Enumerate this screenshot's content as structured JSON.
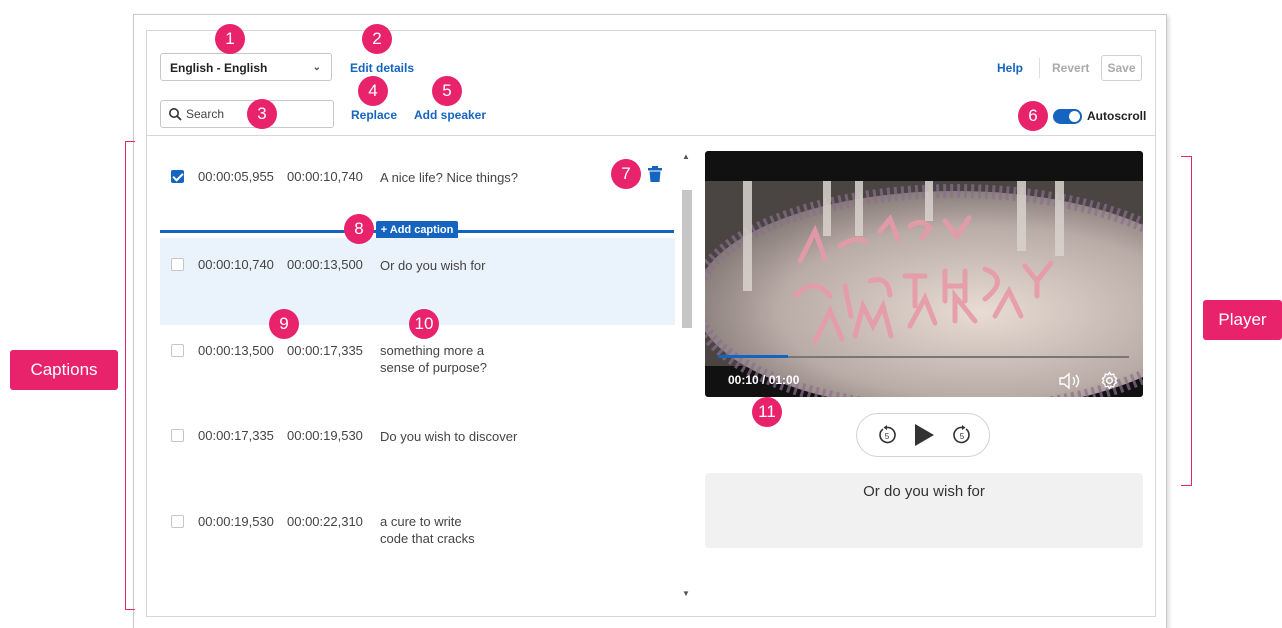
{
  "toolbar": {
    "language": "English - English",
    "edit_details": "Edit details",
    "help": "Help",
    "revert": "Revert",
    "save": "Save",
    "search_placeholder": "Search",
    "replace": "Replace",
    "add_speaker": "Add speaker",
    "autoscroll_label": "Autoscroll",
    "autoscroll_on": true
  },
  "captions": [
    {
      "start": "00:00:05,955",
      "end": "00:00:10,740",
      "text": "A nice life? Nice things?",
      "checked": true
    },
    {
      "start": "00:00:10,740",
      "end": "00:00:13,500",
      "text": "Or do you wish for",
      "checked": false
    },
    {
      "start": "00:00:13,500",
      "end": "00:00:17,335",
      "text_lines": [
        "something more a",
        "sense of purpose?"
      ],
      "checked": false
    },
    {
      "start": "00:00:17,335",
      "end": "00:00:19,530",
      "text": "Do you wish to discover",
      "checked": false
    },
    {
      "start": "00:00:19,530",
      "end": "00:00:22,310",
      "text_lines": [
        "a cure to write",
        "code that cracks"
      ],
      "checked": false
    }
  ],
  "add_caption_label": "+ Add caption",
  "player": {
    "timecode": "00:10 / 01:00",
    "progress_fraction": 0.17,
    "current_caption": "Or do you wish for"
  },
  "annotations": {
    "badges": [
      "1",
      "2",
      "3",
      "4",
      "5",
      "6",
      "7",
      "8",
      "9",
      "10",
      "11"
    ],
    "captions_tag": "Captions",
    "player_tag": "Player"
  },
  "colors": {
    "accent": "#1565c0",
    "annotation": "#e8236b",
    "highlight_row": "#eaf2fb"
  }
}
